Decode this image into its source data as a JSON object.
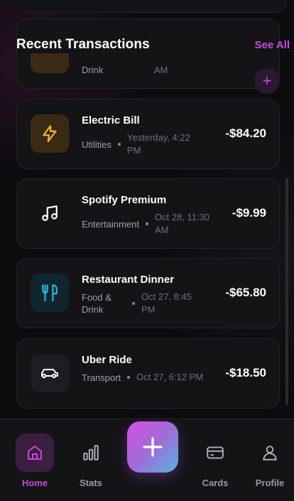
{
  "header": {
    "title": "Recent Transactions",
    "see_all": "See All"
  },
  "partial_transaction": {
    "category": "Drink",
    "time": "AM",
    "icon": "partial-icon"
  },
  "add_small_label": "+",
  "transactions": [
    {
      "name": "Electric Bill",
      "category": "Utilities",
      "time": "Yesterday, 4:22 PM",
      "amount": "-$84.20",
      "icon": "lightning-icon",
      "icon_bg": "#3a2a14",
      "icon_color": "#f5b62a"
    },
    {
      "name": "Spotify Premium",
      "category": "Entertainment",
      "time": "Oct 28, 11:30 AM",
      "amount": "-$9.99",
      "icon": "music-note-icon",
      "icon_bg": "#141417",
      "icon_color": "#ffffff"
    },
    {
      "name": "Restaurant Dinner",
      "category": "Food & Drink",
      "time": "Oct 27, 8:45 PM",
      "amount": "-$65.80",
      "icon": "fork-knife-icon",
      "icon_bg": "#10262e",
      "icon_color": "#2fb7d6"
    },
    {
      "name": "Uber Ride",
      "category": "Transport",
      "time": "Oct 27, 6:12 PM",
      "amount": "-$18.50",
      "icon": "car-icon",
      "icon_bg": "#1e1e22",
      "icon_color": "#ffffff"
    }
  ],
  "nav": {
    "home": "Home",
    "stats": "Stats",
    "cards": "Cards",
    "profile": "Profile"
  },
  "colors": {
    "accent": "#c64bdc",
    "background": "#0c0c0f",
    "card": "#141417"
  }
}
